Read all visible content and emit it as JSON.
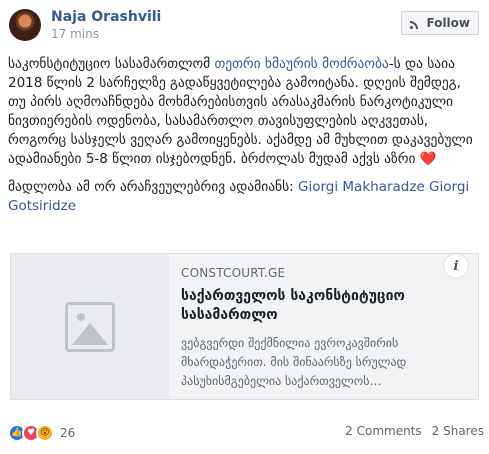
{
  "author": {
    "name": "Naja Orashvili",
    "time": "17 mins"
  },
  "follow_label": "Follow",
  "post": {
    "p1_a": "საკონსტიტუციო სასამართლომ ",
    "p1_link": "თეთრი ხმაურის მოძრაობა",
    "p1_b": "-ს და საია 2018 წლის 2 სარჩელზე გადაწყვეტილება გამოიტანა. დღეის შემდეგ, თუ პირს აღმოაჩნდება მოხმარებისთვის არასაკმარის ნარკოტიკული ნივთიერების ოდენობა, სასამართლო თავისუფლების აღკვეთას, როგორც სასჯელს ვეღარ გამოიყენებს. აქამდე ამ მუხლით დაკავებული ადამიანები 5-8 წლით ისჯებოდნენ. ბრძოლას მუდამ აქვს აზრი",
    "heart": "❤️",
    "p2_a": "მადლობა ამ ორ არაჩვეულებრივ ადამიანს: ",
    "p2_link": "Giorgi Makharadze Giorgi Gotsiridze"
  },
  "card": {
    "domain": "CONSTCOURT.GE",
    "title": "საქართველოს საკონსტიტუციო სასამართლო",
    "description": "ვებგვერდი შექმნილია ევროკავშირის მხარდაჭერით. მის შინაარსზე სრულად პასუხისმგებელია საქართველოს…",
    "info": "i"
  },
  "footer": {
    "reaction_count": "26",
    "comments": "2 Comments",
    "shares": "2 Shares"
  }
}
